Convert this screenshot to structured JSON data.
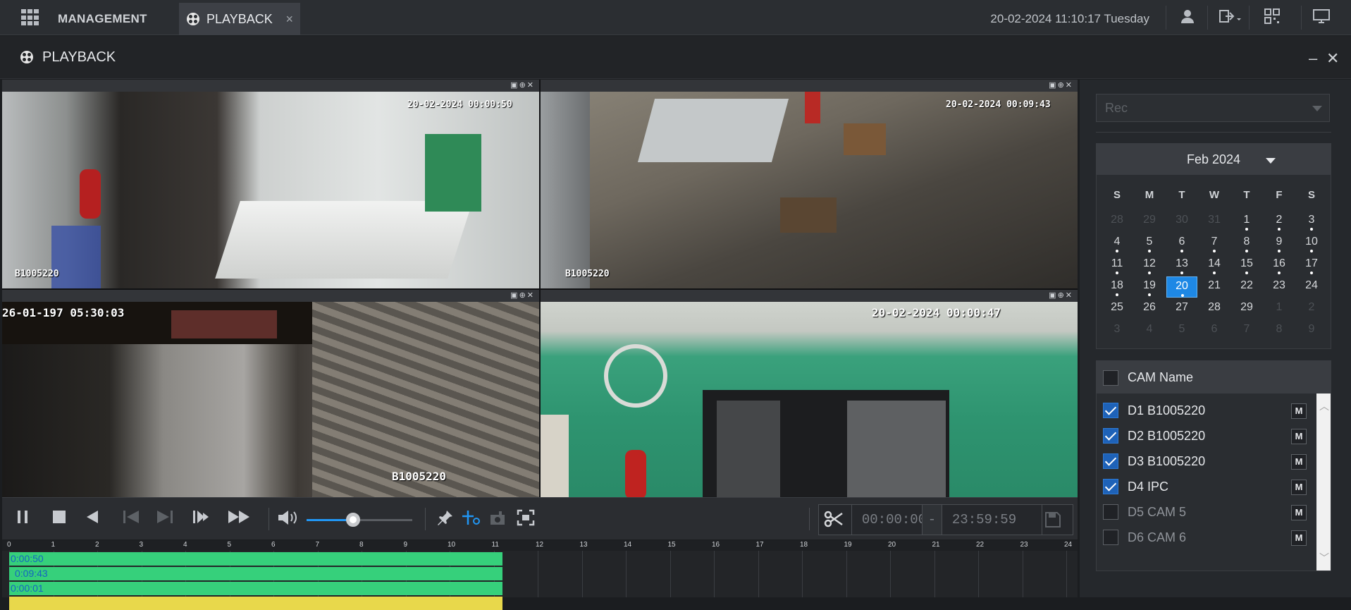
{
  "topbar": {
    "management_label": "MANAGEMENT",
    "tab_label": "PLAYBACK",
    "tab_close": "×",
    "datetime": "20-02-2024 11:10:17 Tuesday",
    "icons": [
      "user-icon",
      "logout-icon",
      "qr-code-icon",
      "monitor-icon"
    ]
  },
  "titlebar": {
    "title": "PLAYBACK",
    "minimize": "–",
    "close": "✕"
  },
  "cameras": [
    {
      "osd_time": "20-02-2024 00:00:50",
      "osd_name": "B1005220",
      "selected": true
    },
    {
      "osd_time": "20-02-2024 00:09:43",
      "osd_name": "B1005220",
      "selected": false
    },
    {
      "osd_time": "26-01-197  05:30:03",
      "osd_name": "B1005220",
      "selected": false
    },
    {
      "osd_time": "20-02-2024 00:00:47",
      "osd_name": "",
      "selected": false
    }
  ],
  "cam_header_controls": "▣⊕✕",
  "controls": {
    "volume_percent": 44,
    "clip_start": "00:00:00",
    "clip_dash": "-",
    "clip_end": "23:59:59"
  },
  "timeline": {
    "ticks": [
      "0",
      "1",
      "2",
      "3",
      "4",
      "5",
      "6",
      "7",
      "8",
      "9",
      "10",
      "11",
      "12",
      "13",
      "14",
      "15",
      "16",
      "17",
      "18",
      "19",
      "20",
      "21",
      "22",
      "23",
      "24"
    ],
    "rows": [
      {
        "label": "0:00:50",
        "end_hour": 11.2,
        "alarm": false
      },
      {
        "label": "0:09:43",
        "end_hour": 11.2,
        "alarm": false
      },
      {
        "label": "0:00:01",
        "end_hour": 11.2,
        "alarm": false
      },
      {
        "label": "",
        "end_hour": 11.2,
        "alarm": true
      }
    ]
  },
  "side": {
    "rec_type": "Rec",
    "calendar": {
      "title": "Feb 2024",
      "dow": [
        "S",
        "M",
        "T",
        "W",
        "T",
        "F",
        "S"
      ],
      "weeks": [
        [
          {
            "d": "28",
            "dim": true
          },
          {
            "d": "29",
            "dim": true
          },
          {
            "d": "30",
            "dim": true
          },
          {
            "d": "31",
            "dim": true
          },
          {
            "d": "1",
            "dot": true
          },
          {
            "d": "2",
            "dot": true
          },
          {
            "d": "3",
            "dot": true
          }
        ],
        [
          {
            "d": "4",
            "dot": true
          },
          {
            "d": "5",
            "dot": true
          },
          {
            "d": "6",
            "dot": true
          },
          {
            "d": "7",
            "dot": true
          },
          {
            "d": "8",
            "dot": true
          },
          {
            "d": "9",
            "dot": true
          },
          {
            "d": "10",
            "dot": true
          }
        ],
        [
          {
            "d": "11",
            "dot": true
          },
          {
            "d": "12",
            "dot": true
          },
          {
            "d": "13",
            "dot": true
          },
          {
            "d": "14",
            "dot": true
          },
          {
            "d": "15",
            "dot": true
          },
          {
            "d": "16",
            "dot": true
          },
          {
            "d": "17",
            "dot": true
          }
        ],
        [
          {
            "d": "18",
            "dot": true
          },
          {
            "d": "19",
            "dot": true
          },
          {
            "d": "20",
            "dot": true,
            "sel": true
          },
          {
            "d": "21"
          },
          {
            "d": "22"
          },
          {
            "d": "23"
          },
          {
            "d": "24"
          }
        ],
        [
          {
            "d": "25"
          },
          {
            "d": "26"
          },
          {
            "d": "27"
          },
          {
            "d": "28"
          },
          {
            "d": "29"
          },
          {
            "d": "1",
            "dim": true
          },
          {
            "d": "2",
            "dim": true
          }
        ],
        [
          {
            "d": "3",
            "dim": true
          },
          {
            "d": "4",
            "dim": true
          },
          {
            "d": "5",
            "dim": true
          },
          {
            "d": "6",
            "dim": true
          },
          {
            "d": "7",
            "dim": true
          },
          {
            "d": "8",
            "dim": true
          },
          {
            "d": "9",
            "dim": true
          }
        ]
      ]
    },
    "cam_list": {
      "header": "CAM Name",
      "m_label": "M",
      "items": [
        {
          "name": "D1 B1005220",
          "checked": true
        },
        {
          "name": "D2 B1005220",
          "checked": true
        },
        {
          "name": "D3 B1005220",
          "checked": true
        },
        {
          "name": "D4 IPC",
          "checked": true
        },
        {
          "name": "D5 CAM 5",
          "checked": false
        },
        {
          "name": "D6 CAM 6",
          "checked": false
        }
      ]
    }
  }
}
